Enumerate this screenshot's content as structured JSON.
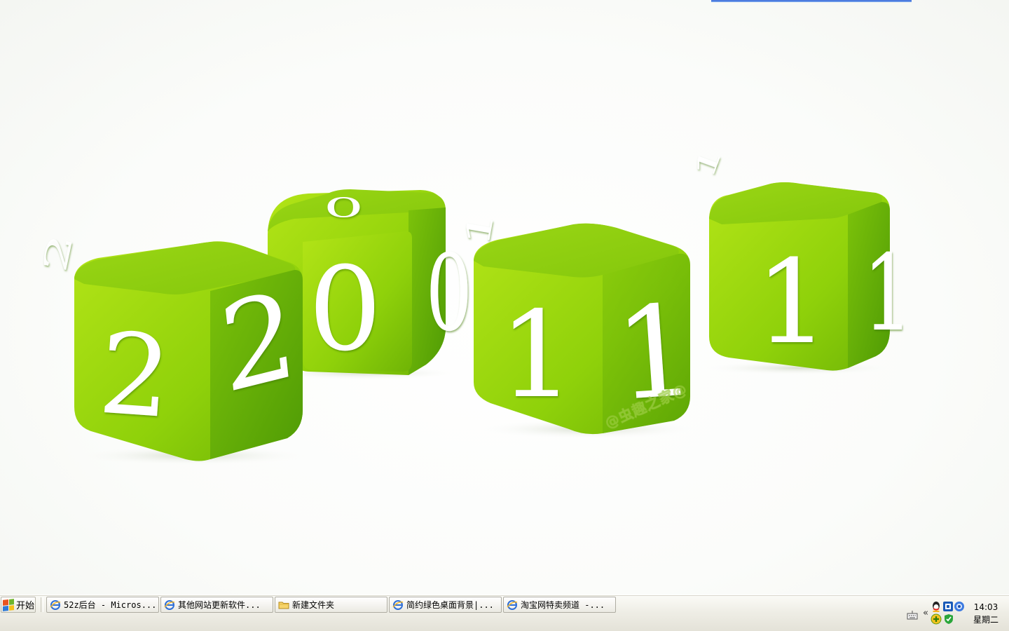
{
  "desktop": {
    "wallpaper_digits": [
      "2",
      "0",
      "1",
      "1"
    ],
    "watermark": "@虫趣之家@",
    "accent_colors": {
      "cube_green": "#8fd10a",
      "cube_dark": "#4f9b05",
      "digit": "#ffffff"
    }
  },
  "taskbar": {
    "start_label": "开始",
    "tasks": [
      {
        "label": "52z后台 - Micros...",
        "icon": "ie-icon"
      },
      {
        "label": "其他网站更新软件...",
        "icon": "ie-icon"
      },
      {
        "label": "新建文件夹",
        "icon": "folder-icon"
      },
      {
        "label": "简约绿色桌面背景|...",
        "icon": "ie-icon"
      },
      {
        "label": "淘宝网特卖频道 -...",
        "icon": "ie-icon"
      }
    ],
    "tray": {
      "expand_symbol": "«",
      "icons": [
        "qq-icon",
        "app-icon",
        "globe-icon",
        "add-icon",
        "shield-icon",
        "keyboard-icon"
      ]
    },
    "clock": {
      "time": "14:03",
      "weekday": "星期二"
    }
  }
}
